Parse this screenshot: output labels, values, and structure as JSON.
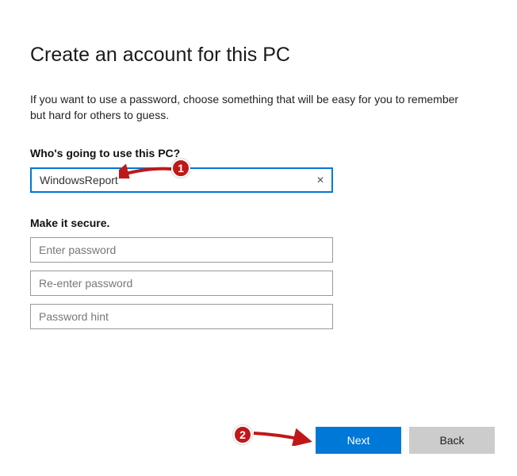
{
  "title": "Create an account for this PC",
  "description": "If you want to use a password, choose something that will be easy for you to remember but hard for others to guess.",
  "username_section": {
    "label": "Who's going to use this PC?",
    "value": "WindowsReport",
    "clear_symbol": "✕"
  },
  "password_section": {
    "label": "Make it secure.",
    "password_placeholder": "Enter password",
    "confirm_placeholder": "Re-enter password",
    "hint_placeholder": "Password hint"
  },
  "buttons": {
    "next": "Next",
    "back": "Back"
  },
  "annotations": {
    "badge1": "1",
    "badge2": "2"
  }
}
